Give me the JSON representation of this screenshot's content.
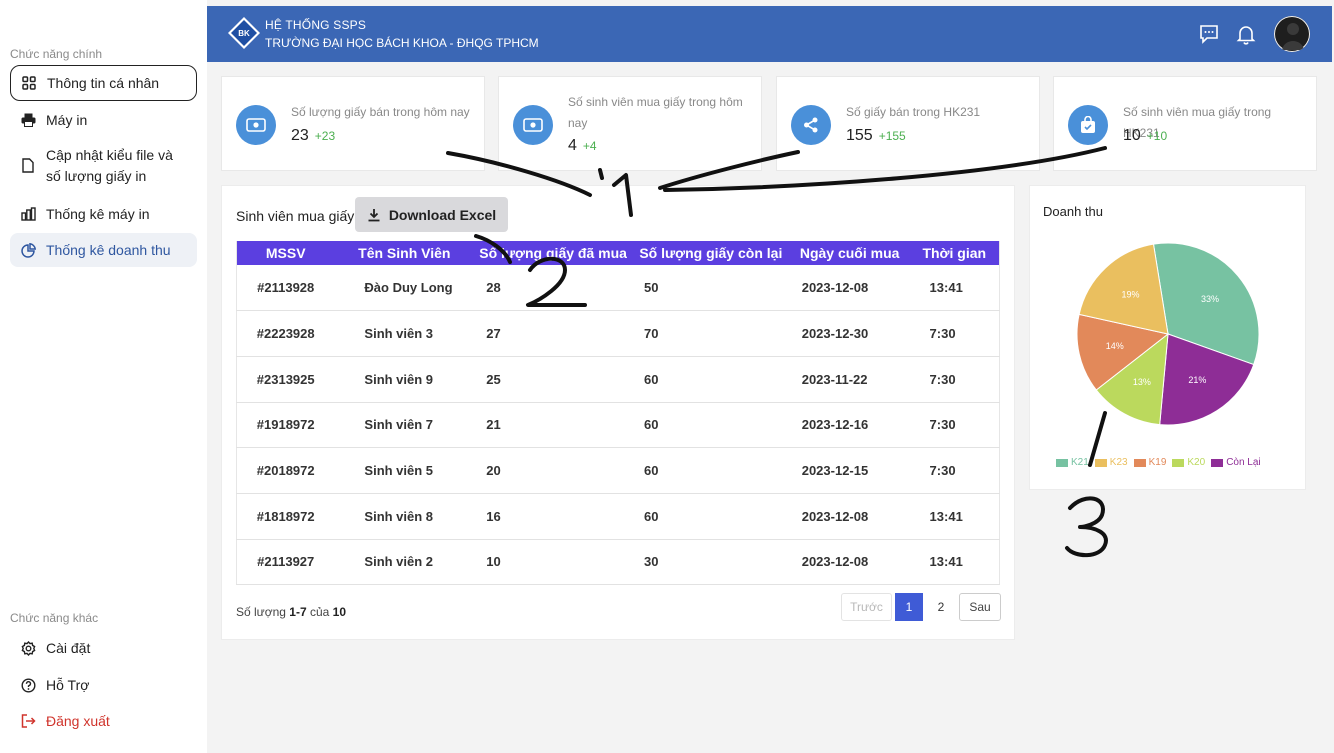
{
  "sidebar": {
    "main_title": "Chức năng chính",
    "other_title": "Chức năng khác",
    "items": [
      {
        "label": "Thông tin cá nhân",
        "icon": "grid-icon"
      },
      {
        "label": "Máy in",
        "icon": "printer-icon"
      },
      {
        "label": "Cập nhật kiểu file và số lượng giấy in",
        "icon": "file-icon"
      },
      {
        "label": "Thống kê máy in",
        "icon": "bar-chart-icon"
      },
      {
        "label": "Thống kê doanh thu",
        "icon": "pie-chart-icon"
      }
    ],
    "other_items": [
      {
        "label": "Cài đặt",
        "icon": "gear-icon"
      },
      {
        "label": "Hỗ Trợ",
        "icon": "help-icon"
      },
      {
        "label": "Đăng xuất",
        "icon": "logout-icon"
      }
    ]
  },
  "header": {
    "logo_text": "BK",
    "brand_line1": "HỆ THỐNG SSPS",
    "brand_line2": "TRƯỜNG ĐẠI HỌC BÁCH KHOA - ĐHQG TPHCM",
    "icons": [
      "chat-icon",
      "bell-icon"
    ]
  },
  "stats": [
    {
      "label": "Số lượng giấy bán trong hôm nay",
      "value": "23",
      "delta": "+23",
      "icon": "money-icon"
    },
    {
      "label": "Số sinh viên mua giấy trong hôm nay",
      "value": "4",
      "delta": "+4",
      "icon": "money-icon"
    },
    {
      "label": "Số giấy bán trong HK231",
      "value": "155",
      "delta": "+155",
      "icon": "share-icon"
    },
    {
      "label": "Số sinh viên mua giấy trong HK231",
      "value": "10",
      "delta": "+10",
      "icon": "bag-icon"
    }
  ],
  "table": {
    "title": "Sinh viên mua giấy",
    "download_label": "Download Excel",
    "headers": [
      "MSSV",
      "Tên Sinh Viên",
      "Số lượng giấy đã mua",
      "Số lượng giấy còn lại",
      "Ngày cuối mua",
      "Thời gian"
    ],
    "rows": [
      [
        "#2113928",
        "Đào Duy Long",
        "28",
        "50",
        "2023-12-08",
        "13:41"
      ],
      [
        "#2223928",
        "Sinh viên 3",
        "27",
        "70",
        "2023-12-30",
        "7:30"
      ],
      [
        "#2313925",
        "Sinh viên 9",
        "25",
        "60",
        "2023-11-22",
        "7:30"
      ],
      [
        "#1918972",
        "Sinh viên 7",
        "21",
        "60",
        "2023-12-16",
        "7:30"
      ],
      [
        "#2018972",
        "Sinh viên 5",
        "20",
        "60",
        "2023-12-15",
        "7:30"
      ],
      [
        "#1818972",
        "Sinh viên 8",
        "16",
        "60",
        "2023-12-08",
        "13:41"
      ],
      [
        "#2113927",
        "Sinh viên 2",
        "10",
        "30",
        "2023-12-08",
        "13:41"
      ]
    ],
    "count_prefix": "Số lượng",
    "count_range": "1-7",
    "count_of": "của",
    "count_total": "10",
    "pagination": {
      "prev": "Trước",
      "pages": [
        "1",
        "2"
      ],
      "next": "Sau",
      "current": "1"
    }
  },
  "chart_data": {
    "type": "pie",
    "title": "Doanh thu",
    "categories": [
      "K21",
      "K23",
      "K19",
      "K20",
      "Còn Lại"
    ],
    "values": [
      33,
      19,
      14,
      13,
      21
    ],
    "colors": [
      "#77c2a2",
      "#eabf5f",
      "#e2895a",
      "#bbd95d",
      "#8e2d96"
    ],
    "labels": [
      "33%",
      "19%",
      "14%",
      "13%",
      "21%"
    ]
  },
  "annotations": [
    "1",
    "2",
    "3"
  ]
}
